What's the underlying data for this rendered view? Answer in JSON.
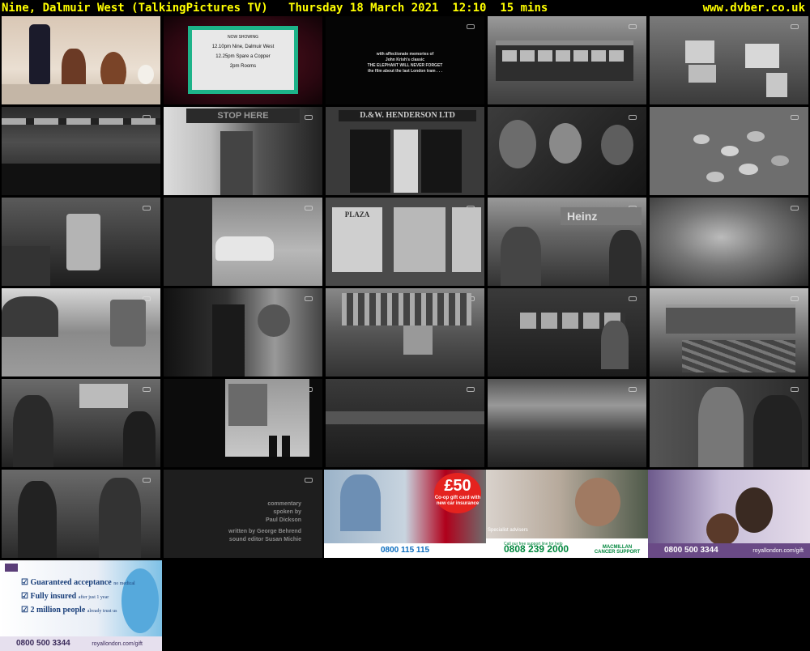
{
  "header": {
    "channel": "Nine, Dalmuir West (TalkingPictures TV)",
    "date": "Thursday 18 March 2021",
    "time": "12:10",
    "duration": "15 mins",
    "site": "www.dvber.co.uk"
  },
  "colors": {
    "header_text": "#ffff00",
    "background": "#000000"
  },
  "thumbnails": [
    {
      "desc": "cocktail-glasses"
    },
    {
      "desc": "cinema-screen"
    },
    {
      "desc": "title-card"
    },
    {
      "desc": "tram-street"
    },
    {
      "desc": "hoarding-posters"
    },
    {
      "desc": "depot-crowd"
    },
    {
      "desc": "stop-here-sign"
    },
    {
      "desc": "henderson-gate"
    },
    {
      "desc": "passengers"
    },
    {
      "desc": "coins"
    },
    {
      "desc": "tram-depot"
    },
    {
      "desc": "car-street"
    },
    {
      "desc": "plaza-posters"
    },
    {
      "desc": "heinz-tram"
    },
    {
      "desc": "woman-closeup"
    },
    {
      "desc": "tram-road"
    },
    {
      "desc": "conductor"
    },
    {
      "desc": "station-hall"
    },
    {
      "desc": "tram-interior"
    },
    {
      "desc": "tram-wreck"
    },
    {
      "desc": "staff-room"
    },
    {
      "desc": "doorway-street"
    },
    {
      "desc": "blur-dark"
    },
    {
      "desc": "blur-motion"
    },
    {
      "desc": "couple"
    },
    {
      "desc": "dance"
    },
    {
      "desc": "credits-card"
    },
    {
      "desc": "coop-ad"
    },
    {
      "desc": "macmillan-ad"
    },
    {
      "desc": "royal-london-ad"
    },
    {
      "desc": "royal-london-balloons"
    }
  ],
  "cinema": {
    "now_showing": "NOW SHOWING",
    "line1": "12.10pm Nine, Dalmuir West",
    "line2": "12.25pm Spare a Copper",
    "line3": "2pm Rooms"
  },
  "title_card": {
    "line1": "with affectionate memories of",
    "line2": "John Krish's classic",
    "line3": "THE ELEPHANT WILL NEVER FORGET",
    "line4": "the film about the last London tram . . ."
  },
  "signs": {
    "stop_here": "STOP HERE",
    "henderson": "D.&W. HENDERSON LTD",
    "plaza": "PLAZA",
    "heinz": "Heinz"
  },
  "credits": {
    "line1": "commentary",
    "line2": "spoken by",
    "line3": "Paul Dickson",
    "line4": "written by George Behrend",
    "line5": "sound editor Susan Michie"
  },
  "ads": {
    "coop": {
      "badge_big": "£50",
      "badge_small": "Co-op gift card with new car insurance",
      "phone": "0800 115 115"
    },
    "macmillan": {
      "tag": "Specialist advisers",
      "line": "Call our free support line for help",
      "phone": "0808 239 2000",
      "brand": "MACMILLAN CANCER SUPPORT"
    },
    "royal_london": {
      "phone": "0800 500 3344",
      "site": "royallondon.com/gift"
    },
    "royal_london_2": {
      "check1": "Guaranteed acceptance",
      "check1_note": "no medical",
      "check2": "Fully insured",
      "check2_note": "after just 1 year",
      "check3": "2 million people",
      "check3_note": "already trust us",
      "phone": "0800 500 3344",
      "site": "royallondon.com/gift"
    }
  }
}
